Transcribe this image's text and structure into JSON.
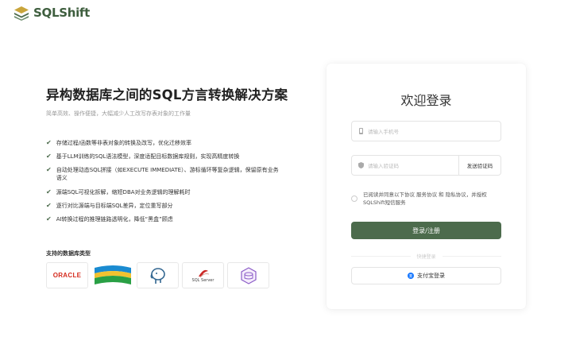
{
  "brand": {
    "name": "SQLShift"
  },
  "hero": {
    "title": "异构数据库之间的SQL方言转换解决方案",
    "subtitle": "简单高效、操作便捷，大幅减少人工改写存表对象的工作量"
  },
  "features": [
    {
      "text": "存储过程/函数等非表对象的转换及改写，优化迁移效率"
    },
    {
      "text": "基于LLM训练的SQL语法模型，深度适配目标数据库规则，实现高精度转换"
    },
    {
      "text": "自动处理动态SQL拼接（如EXECUTE IMMEDIATE）、游标循环等复杂逻辑，保留原有业务语义"
    },
    {
      "text": "源端SQL可视化拆解，缩短DBA对业务逻辑的理解耗时"
    },
    {
      "text": "逐行对比源端与目标端SQL差异，定位重写部分"
    },
    {
      "text": "AI转换过程的推理链路透明化，降低“黑盒”顾虑"
    }
  ],
  "databases": {
    "label": "支持的数据库类型",
    "items": [
      {
        "name": "ORACLE"
      },
      {
        "name": ""
      },
      {
        "name": ""
      },
      {
        "name": "SQL Server"
      },
      {
        "name": ""
      }
    ]
  },
  "login": {
    "title": "欢迎登录",
    "phone_placeholder": "请输入手机号",
    "code_placeholder": "请输入验证码",
    "send_code": "发送验证码",
    "agreement": "已阅读并同意以下协议 服务协议 和 隐私协议，并授权SQLShift短信服务",
    "submit": "登录/注册",
    "quick_login": "快捷登录",
    "alipay": "支付宝登录"
  },
  "colors": {
    "brand": "#4c6b4c",
    "oracle": "#d52b1e",
    "alipay": "#1677ff"
  }
}
